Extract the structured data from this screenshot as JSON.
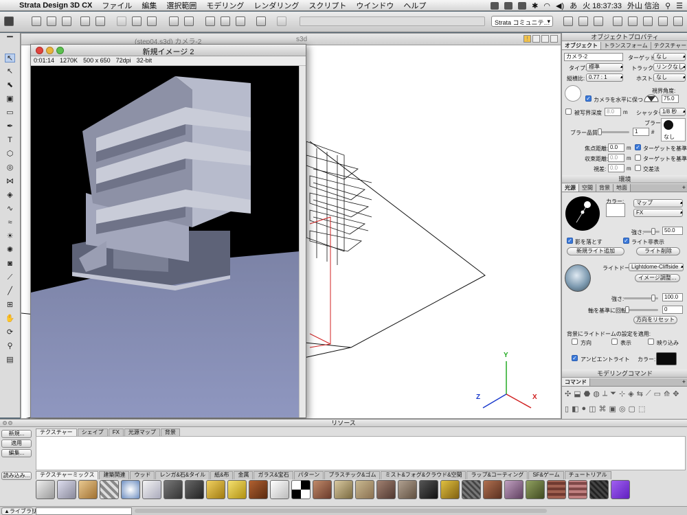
{
  "menubar": {
    "app_name": "Strata Design 3D CX",
    "items": [
      "ファイル",
      "編集",
      "選択範囲",
      "モデリング",
      "レンダリング",
      "スクリプト",
      "ウインドウ",
      "ヘルプ"
    ],
    "input_method": "あ",
    "clock": "火 18:37:33",
    "user": "外山 信治"
  },
  "toolbar": {
    "community_menu": "Strata コミュニテ…"
  },
  "doc_window": {
    "title": "(step04.s3d) カメラ-2",
    "title_right": "s3d"
  },
  "render_window": {
    "title": "新規イメージ 2",
    "info": [
      "0:01:14",
      "1270K",
      "500 x 650",
      "72dpi",
      "32-bit"
    ]
  },
  "object_props": {
    "title": "オブジェクトプロパティ",
    "tabs": [
      "オブジェクト",
      "トランスフォーム",
      "テクスチャー"
    ],
    "name": "カメラ-2",
    "target_label": "ターゲット:",
    "target_value": "なし",
    "type_label": "タイプ:",
    "type_value": "標準",
    "track_label": "トラック:",
    "track_value": "リンクなし",
    "aspect_label": "縦横比:",
    "aspect_value": "0.77 : 1",
    "host_label": "ホスト:",
    "host_value": "なし",
    "fov_label": "視界角度:",
    "fov_value": "75.0",
    "level_label": "カメラを水平に保つ",
    "dof_label": "被写界深度",
    "dof_value": "8.0",
    "dof_unit": "m",
    "shutter_label": "シャッター:",
    "shutter_value": "1/8 秒",
    "blur_label": "ブラー:",
    "blur_quality_label": "ブラー品質:",
    "blur_quality_value": "1",
    "blur_none": "なし",
    "hash": "#",
    "focal_label": "焦点距離:",
    "focal_value": "0.0",
    "unit_m": "m",
    "near_label": "収束距離:",
    "near_value": "0.0",
    "parallax_label": "視差:",
    "parallax_value": "0.0",
    "target_ref1": "ターゲットを基準に",
    "target_ref2": "ターゲットを基準に",
    "cross_label": "交差法"
  },
  "environment": {
    "title": "環境",
    "tabs": [
      "光源",
      "空間",
      "背景",
      "地面"
    ],
    "color_label": "カラー:",
    "map_value": "マップ",
    "fx_value": "FX",
    "strength_label": "強さ:",
    "strength_value": "50.0",
    "cast_shadow": "影を落とす",
    "show_light": "ライト非表示",
    "add_light": "新規ライト追加",
    "delete_light": "ライト削除",
    "dome_label": "ライトドーム:",
    "dome_value": "Lightdome-Cliffside",
    "image_adjust": "イメージ調整…",
    "dome_strength_label": "強さ:",
    "dome_strength_value": "100.0",
    "axis_rotation_label": "軸を基準に回転:",
    "axis_rotation_value": "0",
    "reset_direction": "方向をリセット",
    "apply_label": "背景にライトドームの設定を適用:",
    "apply_options": [
      "方向",
      "表示",
      "映り込み"
    ],
    "ambient_label": "アンビエントライト",
    "ambient_color_label": "カラー:"
  },
  "modeling": {
    "title": "モデリングコマンド",
    "tab": "コマンド"
  },
  "resources": {
    "title": "リソース",
    "buttons": [
      "新規...",
      "適用",
      "編集...",
      "読み込み..."
    ],
    "tabs": [
      "テクスチャー",
      "シェイプ",
      "FX",
      "光源マップ",
      "背景"
    ],
    "category_tabs": [
      "テクスチャーミックス",
      "建築関連",
      "ウッド",
      "レンガ&石&タイル",
      "紙&布",
      "金属",
      "ガラス&宝石",
      "パターン",
      "プラスチック&ゴム",
      "ミスト&フォグ&クラウド&空間",
      "ラップ&コーティング",
      "SF&ゲーム",
      "チュートリアル"
    ],
    "library": "▲ライブラリ"
  },
  "axes": {
    "y": "Y",
    "x": "X",
    "z": "Z"
  },
  "colors": {
    "menubar": "#e6e6e6",
    "render_sky": "#000000",
    "render_ground": "#8c93b8",
    "accent_blue": "#3a78d8",
    "close_red": "#e0443e",
    "min_yellow": "#e8b33a",
    "max_green": "#5cc04f"
  }
}
